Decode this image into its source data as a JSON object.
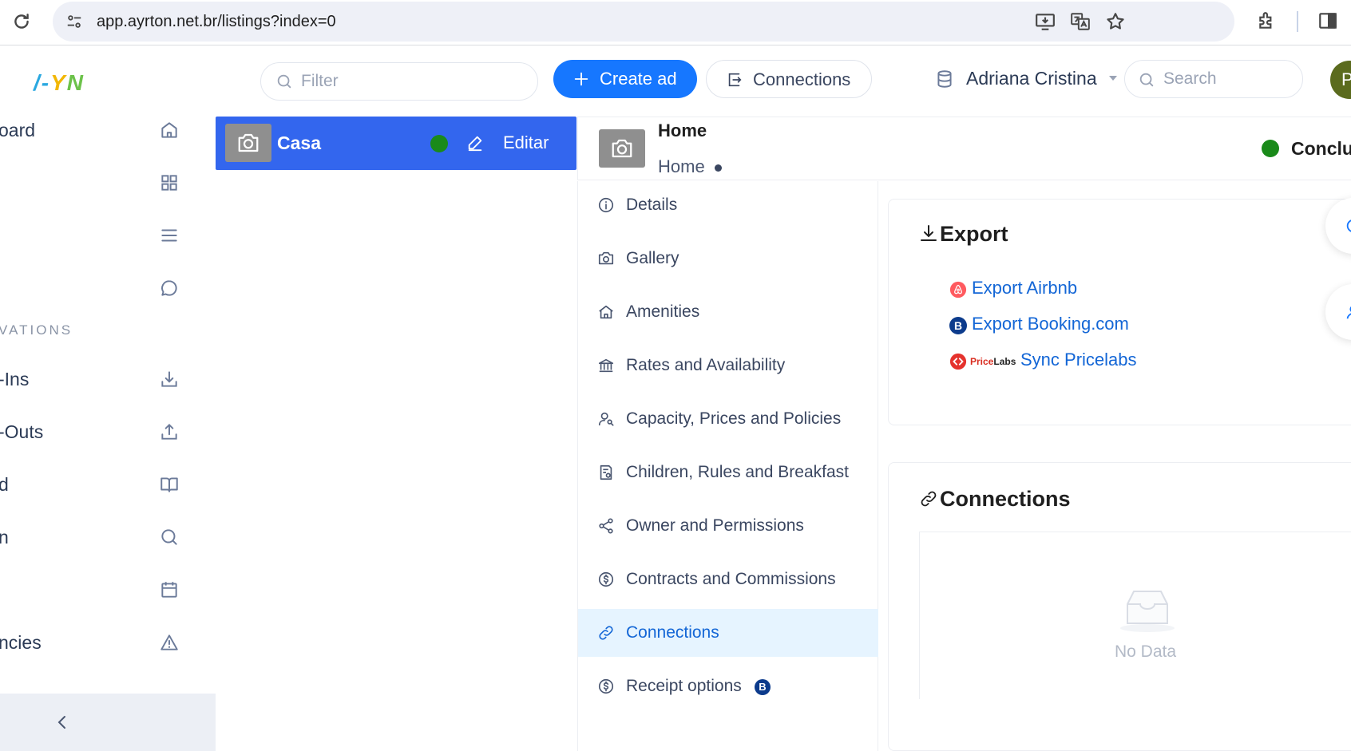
{
  "browser": {
    "url": "app.ayrton.net.br/listings?index=0"
  },
  "sidebar": {
    "logo": {
      "p1": "/-",
      "p2": "Y",
      "p3": "N"
    },
    "items": [
      {
        "label": "oard",
        "icon": "home-icon"
      },
      {
        "label": "",
        "icon": "grid-icon"
      },
      {
        "label": "",
        "icon": "list-icon"
      },
      {
        "label": "",
        "icon": "chat-icon"
      },
      {
        "label": "-Ins",
        "icon": "download-icon"
      },
      {
        "label": "-Outs",
        "icon": "upload-icon"
      },
      {
        "label": "d",
        "icon": "book-icon"
      },
      {
        "label": "n",
        "icon": "search-icon"
      },
      {
        "label": "",
        "icon": "calendar-icon"
      },
      {
        "label": "ncies",
        "icon": "warning-icon"
      }
    ],
    "section_label": "VATIONS"
  },
  "toolbar": {
    "filter_placeholder": "Filter",
    "create_label": "Create ad",
    "connections_label": "Connections",
    "account_name": "Adriana Cristina",
    "search_placeholder": "Search",
    "avatar_initial": "P"
  },
  "listing": {
    "name": "Casa",
    "edit_label": "Editar",
    "status_color": "#1a8a1a"
  },
  "detail": {
    "title": "Home",
    "subtitle": "Home",
    "status_label": "Conclu"
  },
  "menu": {
    "items": [
      {
        "label": "Details",
        "icon": "info-icon"
      },
      {
        "label": "Gallery",
        "icon": "camera-icon"
      },
      {
        "label": "Amenities",
        "icon": "home-icon"
      },
      {
        "label": "Rates and Availability",
        "icon": "bank-icon"
      },
      {
        "label": "Capacity, Prices and Policies",
        "icon": "people-icon"
      },
      {
        "label": "Children, Rules and Breakfast",
        "icon": "document-icon"
      },
      {
        "label": "Owner and Permissions",
        "icon": "share-icon"
      },
      {
        "label": "Contracts and Commissions",
        "icon": "dollar-icon"
      },
      {
        "label": "Connections",
        "icon": "link-icon",
        "active": true
      },
      {
        "label": "Receipt options",
        "icon": "dollar-icon",
        "badge": "B"
      }
    ]
  },
  "export": {
    "title": "Export",
    "links": [
      {
        "label": "Export Airbnb",
        "icon": "airbnb-icon"
      },
      {
        "label": "Export Booking.com",
        "icon": "booking-icon",
        "badge": "B"
      },
      {
        "label": "Sync Pricelabs",
        "icon": "pricelabs-icon",
        "brand_a": "Price",
        "brand_b": "Labs"
      }
    ]
  },
  "connections": {
    "title": "Connections",
    "empty_label": "No Data"
  },
  "colors": {
    "accent": "#1677ff",
    "listing_bg": "#3366ee",
    "active_menu_bg": "#e6f4ff",
    "status_green": "#1a8a1a"
  }
}
